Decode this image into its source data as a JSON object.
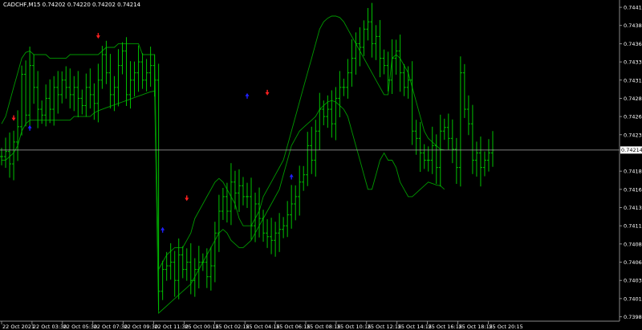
{
  "header": {
    "symbol": "CADCHF,M15",
    "ohlc": "0.74202 0.74220 0.74202 0.74214"
  },
  "colors": {
    "background": "#000000",
    "bars": "#00c000",
    "bands": "#009900",
    "price_line": "#aaaaaa",
    "sell_arrow": "#ff2020",
    "buy_arrow": "#2020ff",
    "axis_text": "#ffffff"
  },
  "current_price": "0.74214",
  "chart_data": {
    "type": "bar",
    "title": "CADCHF,M15",
    "y_ticks": [
      "0.74410",
      "0.74385",
      "0.74360",
      "0.74335",
      "0.74310",
      "0.74285",
      "0.74260",
      "0.74235",
      "0.74185",
      "0.74160",
      "0.74135",
      "0.74110",
      "0.74085",
      "0.74060",
      "0.74035",
      "0.74010",
      "0.73985"
    ],
    "ylim": [
      0.73979,
      0.7442
    ],
    "x_ticks": [
      "22 Oct 2021",
      "22 Oct 03:30",
      "22 Oct 05:30",
      "22 Oct 07:30",
      "22 Oct 09:30",
      "22 Oct 11:30",
      "25 Oct 00:15",
      "25 Oct 02:15",
      "25 Oct 04:15",
      "25 Oct 06:15",
      "25 Oct 08:15",
      "25 Oct 10:15",
      "25 Oct 12:15",
      "25 Oct 14:15",
      "25 Oct 16:15",
      "25 Oct 18:15",
      "25 Oct 20:15"
    ],
    "close_series": [
      0.74205,
      0.74212,
      0.74195,
      0.74225,
      0.74246,
      0.74318,
      0.74262,
      0.7433,
      0.743,
      0.7427,
      0.74262,
      0.74285,
      0.7427,
      0.743,
      0.7429,
      0.7431,
      0.743,
      0.7429,
      0.743,
      0.74285,
      0.74275,
      0.743,
      0.7429,
      0.74278,
      0.7431,
      0.74345,
      0.7432,
      0.7429,
      0.743,
      0.7433,
      0.7435,
      0.7429,
      0.7431,
      0.7432,
      0.74335,
      0.7431,
      0.7432,
      0.7433,
      0.7431,
      0.7402,
      0.7405,
      0.74055,
      0.7406,
      0.74035,
      0.7407,
      0.7405,
      0.7406,
      0.74035,
      0.7405,
      0.7406,
      0.7406,
      0.7404,
      0.74055,
      0.741,
      0.7413,
      0.7415,
      0.7413,
      0.7417,
      0.74155,
      0.74165,
      0.7415,
      0.7415,
      0.7411,
      0.7414,
      0.7412,
      0.741,
      0.74095,
      0.7409,
      0.741,
      0.74105,
      0.7411,
      0.74125,
      0.7414,
      0.7415,
      0.7417,
      0.7418,
      0.7422,
      0.742,
      0.7424,
      0.7427,
      0.7426,
      0.7427,
      0.7425,
      0.74285,
      0.743,
      0.743,
      0.7432,
      0.7434,
      0.7436,
      0.74355,
      0.7438,
      0.7439,
      0.7436,
      0.7437,
      0.7434,
      0.7433,
      0.7431,
      0.7434,
      0.7435,
      0.7432,
      0.743,
      0.7431,
      0.7424,
      0.7423,
      0.7421,
      0.742,
      0.742,
      0.7422,
      0.7419,
      0.7424,
      0.74245,
      0.7423,
      0.74215,
      0.7419,
      0.7432,
      0.7427,
      0.7425,
      0.742,
      0.7421,
      0.7419,
      0.742,
      0.7421,
      0.74214
    ],
    "band_upper": [
      0.7425,
      0.7426,
      0.7428,
      0.743,
      0.7432,
      0.7434,
      0.74348,
      0.7435,
      0.74345,
      0.74345,
      0.74345,
      0.74345,
      0.7434,
      0.7434,
      0.7434,
      0.7434,
      0.7434,
      0.74345,
      0.74345,
      0.74345,
      0.74345,
      0.74345,
      0.74345,
      0.74345,
      0.74345,
      0.7435,
      0.74355,
      0.74355,
      0.74355,
      0.7436,
      0.7436,
      0.7436,
      0.7436,
      0.7436,
      0.7436,
      0.74345,
      0.74345,
      0.74345,
      0.74345,
      0.7405,
      0.7406,
      0.7407,
      0.74075,
      0.7408,
      0.7408,
      0.7408,
      0.7409,
      0.741,
      0.7412,
      0.7413,
      0.7414,
      0.7415,
      0.7416,
      0.7417,
      0.74175,
      0.7417,
      0.7416,
      0.7415,
      0.7414,
      0.7412,
      0.7411,
      0.7411,
      0.7411,
      0.7412,
      0.7413,
      0.7415,
      0.7416,
      0.7417,
      0.7418,
      0.7419,
      0.742,
      0.7422,
      0.7424,
      0.7426,
      0.7428,
      0.743,
      0.7432,
      0.7434,
      0.7436,
      0.7438,
      0.7439,
      0.74395,
      0.74398,
      0.74398,
      0.74396,
      0.7439,
      0.7438,
      0.7437,
      0.7436,
      0.7435,
      0.7434,
      0.7433,
      0.7432,
      0.7431,
      0.743,
      0.7429,
      0.7429,
      0.7434,
      0.74345,
      0.7434,
      0.7433,
      0.7432,
      0.743,
      0.7428,
      0.7426,
      0.7424,
      0.7423,
      0.74225,
      0.7422,
      0.74215,
      0.74214
    ],
    "band_lower": [
      0.742,
      0.742,
      0.74205,
      0.7421,
      0.7422,
      0.7424,
      0.7425,
      0.74255,
      0.74255,
      0.74255,
      0.74255,
      0.74255,
      0.74255,
      0.74255,
      0.74255,
      0.74255,
      0.74255,
      0.74255,
      0.7426,
      0.7426,
      0.7426,
      0.7426,
      0.7426,
      0.74265,
      0.74268,
      0.7427,
      0.74272,
      0.74274,
      0.74276,
      0.74278,
      0.7428,
      0.74282,
      0.74284,
      0.74286,
      0.74288,
      0.7429,
      0.74292,
      0.74294,
      0.74295,
      0.7399,
      0.73995,
      0.74,
      0.74005,
      0.7401,
      0.74015,
      0.7402,
      0.74025,
      0.7403,
      0.7404,
      0.7405,
      0.7406,
      0.7407,
      0.7408,
      0.7409,
      0.741,
      0.74105,
      0.741,
      0.7409,
      0.74085,
      0.7408,
      0.7408,
      0.74085,
      0.7409,
      0.741,
      0.7411,
      0.7412,
      0.7413,
      0.7414,
      0.7415,
      0.7416,
      0.7418,
      0.742,
      0.7422,
      0.7423,
      0.7424,
      0.74245,
      0.7425,
      0.74255,
      0.7426,
      0.7427,
      0.74275,
      0.7428,
      0.74282,
      0.7428,
      0.74275,
      0.7427,
      0.7426,
      0.7424,
      0.7422,
      0.742,
      0.7418,
      0.7416,
      0.7416,
      0.7418,
      0.742,
      0.7421,
      0.742,
      0.742,
      0.7419,
      0.7417,
      0.7416,
      0.7415,
      0.7415,
      0.74155,
      0.7416,
      0.74165,
      0.7417,
      0.74168,
      0.74166,
      0.74165,
      0.7416
    ],
    "sell_arrows": [
      [
        3,
        0.74255
      ],
      [
        24,
        0.74368
      ],
      [
        46,
        0.74145
      ],
      [
        66,
        0.7429
      ]
    ],
    "buy_arrows": [
      [
        7,
        0.74245
      ],
      [
        40,
        0.74105
      ],
      [
        61,
        0.74289
      ],
      [
        72,
        0.74178
      ]
    ]
  }
}
